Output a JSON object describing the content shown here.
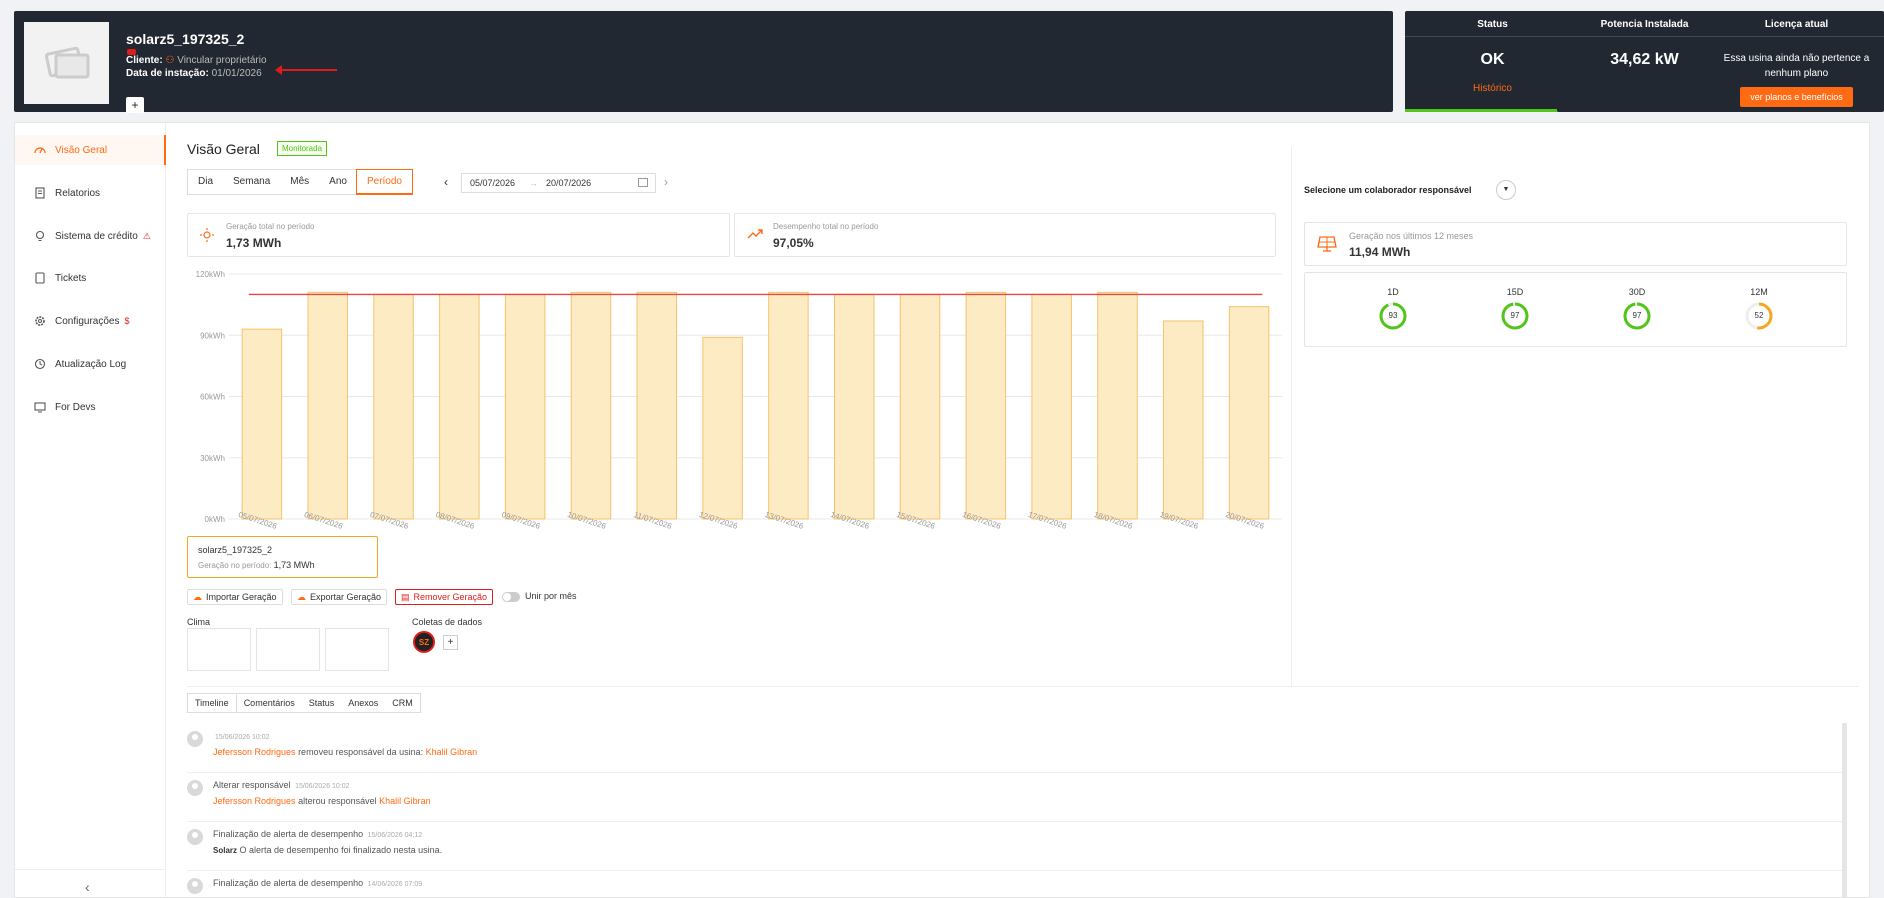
{
  "header": {
    "plant_name": "solarz5_197325_2",
    "cliente_label": "Cliente:",
    "cliente_link": "Vincular proprietário",
    "data_label": "Data de instação:",
    "data_value": "01/01/2026",
    "plus": "+"
  },
  "cards": {
    "status": {
      "title": "Status",
      "value": "OK",
      "sub": "Histórico",
      "bar_color": "#52c41a"
    },
    "potencia": {
      "title": "Potencia Instalada",
      "value": "34,62 kW"
    },
    "licenca": {
      "title": "Licença atual",
      "text": "Essa usina ainda não pertence a nenhum plano",
      "button": "ver planos e benefícios"
    }
  },
  "sidebar": {
    "items": [
      {
        "label": "Visão Geral",
        "icon": "dashboard-icon",
        "active": true
      },
      {
        "label": "Relatorios",
        "icon": "document-icon"
      },
      {
        "label": "Sistema de crédito",
        "icon": "lightbulb-icon",
        "warn": "⚠"
      },
      {
        "label": "Tickets",
        "icon": "ticket-icon"
      },
      {
        "label": "Configurações",
        "icon": "gear-icon",
        "warn": "$"
      },
      {
        "label": "Atualização Log",
        "icon": "log-icon"
      },
      {
        "label": "For Devs",
        "icon": "monitor-icon"
      }
    ],
    "collapse": "‹"
  },
  "main": {
    "title": "Visão Geral",
    "badge": "Monitorada",
    "tabs": [
      "Dia",
      "Semana",
      "Mês",
      "Ano",
      "Período"
    ],
    "active_tab": "Período",
    "date_start": "05/07/2026",
    "date_arrow": "→",
    "date_end": "20/07/2026",
    "stat1": {
      "label": "Geração total no período",
      "value": "1,73 MWh"
    },
    "stat2": {
      "label": "Desempenho total no período",
      "value": "97,05%"
    },
    "plant_card": {
      "name": "solarz5_197325_2",
      "label": "Geração no período:",
      "value": "1,73 MWh"
    },
    "buttons": {
      "import": "Importar Geração",
      "export": "Exportar Geração",
      "remove": "Remover Geração"
    },
    "toggle_label": "Unir por mês",
    "clima_label": "Clima",
    "coletas_label": "Coletas de dados",
    "coleta_avatar": "SZ",
    "coleta_plus": "+"
  },
  "chart_data": {
    "type": "bar",
    "categories": [
      "05/07/2026",
      "06/07/2026",
      "07/07/2026",
      "08/07/2026",
      "09/07/2026",
      "10/07/2026",
      "11/07/2026",
      "12/07/2026",
      "13/07/2026",
      "14/07/2026",
      "15/07/2026",
      "16/07/2026",
      "17/07/2026",
      "18/07/2026",
      "19/07/2026",
      "20/07/2026"
    ],
    "values": [
      93,
      111,
      110,
      110,
      110,
      111,
      111,
      89,
      111,
      110,
      110,
      111,
      110,
      111,
      97,
      104
    ],
    "reference_line": 110,
    "ytick_labels": [
      "0kWh",
      "30kWh",
      "60kWh",
      "90kWh",
      "120kWh"
    ],
    "ylim": [
      0,
      120
    ],
    "bar_color": "#fdebc4",
    "bar_stroke": "#f5c26b",
    "line_color": "#e84545",
    "grid": true
  },
  "right": {
    "collab_label": "Selecione um colaborador responsável",
    "collab_dd": "▼",
    "gen12_label": "Geração nos últimos 12 meses",
    "gen12_value": "11,94 MWh",
    "gauges": [
      {
        "label": "1D",
        "value": "93",
        "pct": 0.93,
        "color": "#52c41a"
      },
      {
        "label": "15D",
        "value": "97",
        "pct": 0.97,
        "color": "#52c41a"
      },
      {
        "label": "30D",
        "value": "97",
        "pct": 0.97,
        "color": "#52c41a"
      },
      {
        "label": "12M",
        "value": "52",
        "pct": 0.52,
        "color": "#f5a623"
      }
    ]
  },
  "timeline": {
    "tabs": [
      "Timeline",
      "Comentários",
      "Status",
      "Anexos",
      "CRM"
    ],
    "entries": [
      {
        "title": "",
        "ts": "15/06/2026 10:02",
        "actor": "Jefersson Rodrigues",
        "text": "removeu responsável da usina:",
        "target": "Khalil Gibran"
      },
      {
        "title": "Alterar responsável",
        "ts": "15/06/2026 10:02",
        "actor": "Jefersson Rodrigues",
        "text": "alterou responsável",
        "target": "Khalil Gibran"
      },
      {
        "title": "Finalização de alerta de desempenho",
        "ts": "15/06/2026 04:12",
        "actor": "Solarz",
        "text": "O alerta de desempenho foi finalizado nesta usina.",
        "target": ""
      },
      {
        "title": "Finalização de alerta de desempenho",
        "ts": "14/06/2026 07:09",
        "actor": "",
        "text": "",
        "target": ""
      }
    ]
  }
}
